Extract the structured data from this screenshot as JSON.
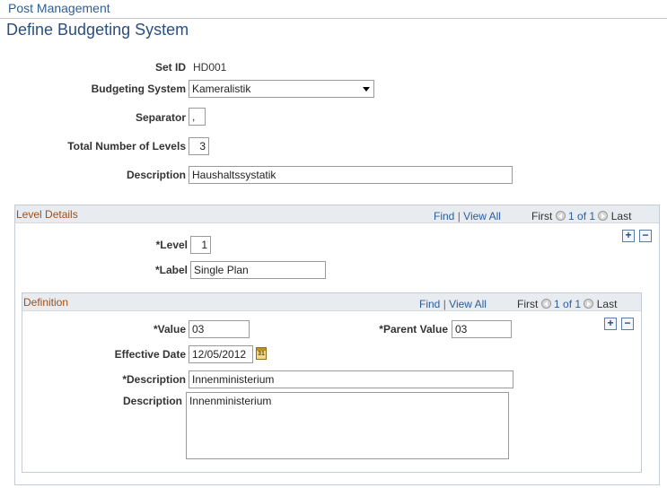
{
  "breadcrumb": "Post Management",
  "page_title": "Define Budgeting System",
  "form": {
    "setid_label": "Set ID",
    "setid_value": "HD001",
    "budgeting_system_label": "Budgeting System",
    "budgeting_system_value": "Kameralistik",
    "separator_label": "Separator",
    "separator_value": ",",
    "total_levels_label": "Total Number of Levels",
    "total_levels_value": "3",
    "description_label": "Description",
    "description_value": "Haushaltssystatik"
  },
  "level_details": {
    "title": "Level Details",
    "find": "Find",
    "divider": "|",
    "view_all": "View All",
    "first": "First",
    "counter": "1 of 1",
    "last": "Last",
    "add_label": "+",
    "delete_label": "−",
    "level_label": "*Level",
    "level_value": "1",
    "label_label": "*Label",
    "label_value": "Single Plan"
  },
  "definition": {
    "title": "Definition",
    "find": "Find",
    "divider": "|",
    "view_all": "View All",
    "first": "First",
    "counter": "1 of 1",
    "last": "Last",
    "add_label": "+",
    "delete_label": "−",
    "value_label": "*Value",
    "value_value": "03",
    "parent_value_label": "*Parent Value",
    "parent_value_value": "03",
    "effective_date_label": "Effective Date",
    "effective_date_value": "12/05/2012",
    "calendar_icon_text": "31",
    "req_description_label": "*Description",
    "req_description_value": "Innenministerium",
    "long_description_label": "Description",
    "long_description_value": "Innenministerium"
  },
  "icons": {
    "prev": "prev-circle-icon",
    "next": "next-circle-icon",
    "calendar": "calendar-icon",
    "dropdown": "chevron-down-icon"
  }
}
